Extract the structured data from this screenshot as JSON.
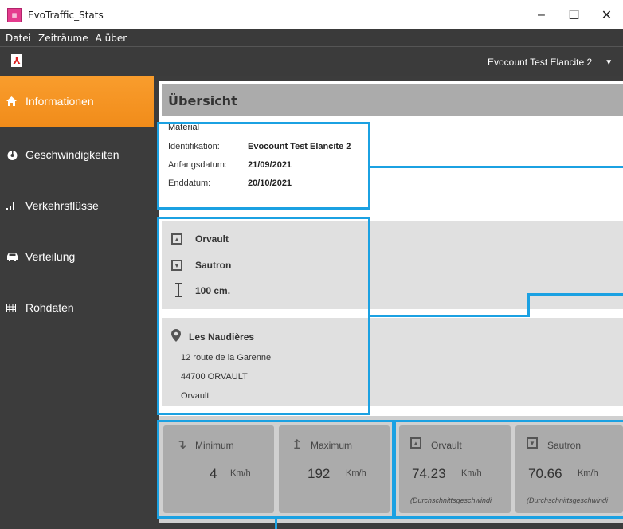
{
  "window": {
    "title": "EvoTraffic_Stats",
    "controls": [
      "–",
      "☐",
      "✕"
    ]
  },
  "menu": [
    "Datei",
    "Zeiträume",
    "A über"
  ],
  "toolbar": {
    "device": "Evocount Test Elancite 2"
  },
  "sidebar": {
    "items": [
      {
        "label": "Informationen",
        "icon": "home-icon",
        "active": true
      },
      {
        "label": "Geschwindigkeiten",
        "icon": "gauge-icon",
        "active": false
      },
      {
        "label": "Verkehrsflüsse",
        "icon": "signal-icon",
        "active": false
      },
      {
        "label": "Verteilung",
        "icon": "car-icon",
        "active": false
      },
      {
        "label": "Rohdaten",
        "icon": "table-icon",
        "active": false
      }
    ]
  },
  "overview": {
    "title": "Übersicht",
    "material": {
      "section": "Material",
      "rows": [
        {
          "key": "Identifikation:",
          "value": "Evocount Test Elancite 2"
        },
        {
          "key": "Anfangsdatum:",
          "value": "21/09/2021"
        },
        {
          "key": "Enddatum:",
          "value": "20/10/2021"
        }
      ]
    },
    "directions": {
      "up": "Orvault",
      "down": "Sautron",
      "distance": "100 cm."
    },
    "location": {
      "name": "Les Naudières",
      "street": "12 route de la Garenne",
      "postal": "44700 ORVAULT",
      "city": "Orvault"
    },
    "stats": [
      {
        "title": "Minimum",
        "value": "4",
        "unit": "Km/h",
        "note": ""
      },
      {
        "title": "Maximum",
        "value": "192",
        "unit": "Km/h",
        "note": ""
      },
      {
        "title": "Orvault",
        "value": "74.23",
        "unit": "Km/h",
        "note": "(Durchschnittsgeschwindi"
      },
      {
        "title": "Sautron",
        "value": "70.66",
        "unit": "Km/h",
        "note": "(Durchschnittsgeschwindi"
      }
    ]
  },
  "colors": {
    "accent": "#f99d2d",
    "highlight": "#1ba1e2",
    "sidebar": "#3c3c3c"
  }
}
